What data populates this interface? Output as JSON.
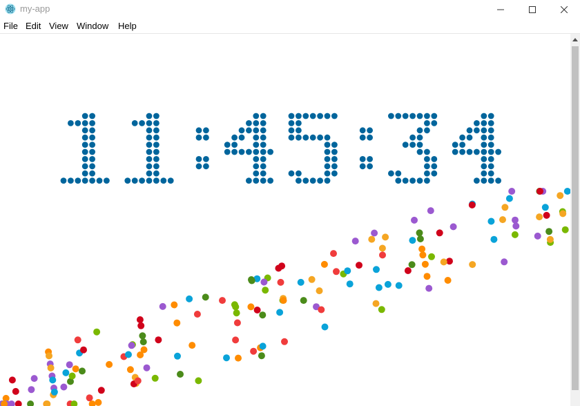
{
  "window": {
    "title": "my-app",
    "icon": "electron-atom-icon"
  },
  "menu": {
    "items": [
      "File",
      "Edit",
      "View",
      "Window",
      "Help"
    ]
  },
  "clock": {
    "time": "11:45:34",
    "dot_color": "#00659c"
  },
  "particle_colors": [
    "#0aa3d9",
    "#f5a623",
    "#d0021b",
    "#9b59d0",
    "#ff8c00",
    "#f03c3c",
    "#7ab800",
    "#4b8b1a"
  ],
  "colors": {
    "title_text": "#999999",
    "scrollbar_track": "#f1f1f1",
    "scrollbar_thumb": "#c1c1c1"
  }
}
